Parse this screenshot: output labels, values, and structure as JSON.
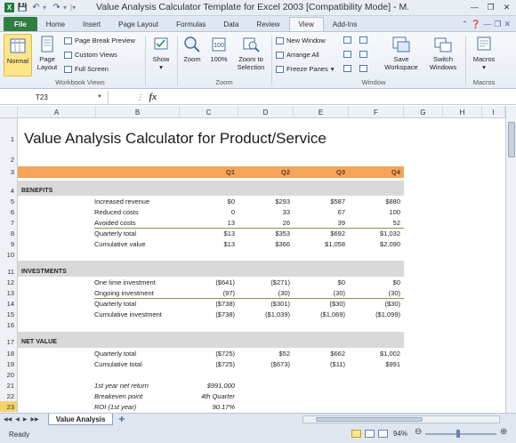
{
  "window": {
    "title": "Value Analysis Calculator Template for Excel 2003  [Compatibility Mode]  -  M.",
    "app_icon": "X"
  },
  "ribbon_tabs": [
    "File",
    "Home",
    "Insert",
    "Page Layout",
    "Formulas",
    "Data",
    "Review",
    "View",
    "Add-Ins"
  ],
  "ribbon": {
    "normal": "Normal",
    "page_layout_1": "Page",
    "page_layout_2": "Layout",
    "page_break_preview": "Page Break Preview",
    "custom_views": "Custom Views",
    "full_screen": "Full Screen",
    "group_workbook_views": "Workbook Views",
    "show": "Show",
    "zoom": "Zoom",
    "zoom_100": "100%",
    "zoom_to_1": "Zoom to",
    "zoom_to_2": "Selection",
    "group_zoom": "Zoom",
    "new_window": "New Window",
    "arrange_all": "Arrange All",
    "freeze_panes": "Freeze Panes",
    "save_workspace_1": "Save",
    "save_workspace_2": "Workspace",
    "switch_windows_1": "Switch",
    "switch_windows_2": "Windows",
    "group_window": "Window",
    "macros": "Macros",
    "group_macros": "Macros"
  },
  "formula_bar": {
    "name_box": "T23",
    "fx": "fx",
    "formula": ""
  },
  "columns": [
    "A",
    "B",
    "C",
    "D",
    "E",
    "F",
    "G",
    "H",
    "I"
  ],
  "rows": [
    "1",
    "2",
    "3",
    "4",
    "5",
    "6",
    "7",
    "8",
    "9",
    "10",
    "11",
    "12",
    "13",
    "14",
    "15",
    "16",
    "17",
    "18",
    "19",
    "20",
    "21",
    "22",
    "23"
  ],
  "sheet": {
    "title": "Value Analysis Calculator for Product/Service",
    "quarters": [
      "Q1",
      "Q2",
      "Q3",
      "Q4"
    ],
    "benefits": {
      "header": "BENEFITS",
      "rows": [
        {
          "label": "Increased revenue",
          "values": [
            "$0",
            "$293",
            "$587",
            "$880"
          ]
        },
        {
          "label": "Reduced costs",
          "values": [
            "0",
            "33",
            "67",
            "100"
          ]
        },
        {
          "label": "Avoided costs",
          "values": [
            "13",
            "26",
            "39",
            "52"
          ]
        },
        {
          "label": "Quarterly total",
          "values": [
            "$13",
            "$353",
            "$692",
            "$1,032"
          ]
        },
        {
          "label": "Cumulative value",
          "values": [
            "$13",
            "$366",
            "$1,058",
            "$2,090"
          ]
        }
      ]
    },
    "investments": {
      "header": "INVESTMENTS",
      "rows": [
        {
          "label": "One time investment",
          "values": [
            "($641)",
            "($271)",
            "$0",
            "$0"
          ]
        },
        {
          "label": "Ongoing investment",
          "values": [
            "(97)",
            "(30)",
            "(30)",
            "(30)"
          ]
        },
        {
          "label": "Quarterly total",
          "values": [
            "($738)",
            "($301)",
            "($30)",
            "($30)"
          ]
        },
        {
          "label": "Cumulative investment",
          "values": [
            "($738)",
            "($1,039)",
            "($1,069)",
            "($1,099)"
          ]
        }
      ]
    },
    "net_value": {
      "header": "NET VALUE",
      "rows": [
        {
          "label": "Quarterly total",
          "values": [
            "($725)",
            "$52",
            "$662",
            "$1,002"
          ]
        },
        {
          "label": "Cumulative total",
          "values": [
            "($725)",
            "($673)",
            "($11)",
            "$991"
          ]
        }
      ]
    },
    "summary": [
      {
        "label": "1st year net return",
        "value": "$991,000"
      },
      {
        "label": "Breakeven point",
        "value": "4th Quarter"
      },
      {
        "label": "ROI (1st year)",
        "value": "90.17%"
      }
    ]
  },
  "sheet_tabs": [
    "Value Analysis"
  ],
  "status": {
    "ready": "Ready",
    "zoom": "94%",
    "zoom_level": 0.94
  },
  "colors": {
    "quarter_band": "#f5a55a",
    "section_band": "#d9d9d9",
    "file_tab": "#2f7d3f"
  }
}
